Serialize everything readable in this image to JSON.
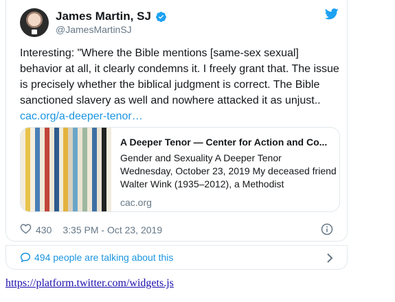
{
  "tweet": {
    "display_name": "James Martin, SJ",
    "handle": "@JamesMartinSJ",
    "text": "Interesting: \"Where the Bible mentions [same-sex sexual] behavior at all, it clearly condemns it. I freely grant that. The issue is precisely whether the biblical judgment is correct. The Bible sanctioned slavery as well and nowhere attacked it as unjust..",
    "link_text": "cac.org/a-deeper-tenor…",
    "likes": "430",
    "timestamp": "3:35 PM - Oct 23, 2019"
  },
  "card": {
    "title": "A Deeper Tenor — Center for Action and Co...",
    "description": "Gender and Sexuality A Deeper Tenor Wednesday, October 23, 2019 My deceased friend Walter Wink (1935–2012), a Methodist",
    "domain": "cac.org",
    "stripe_colors": [
      "#f3ecdc",
      "#e8c24a",
      "#f5efe0",
      "#4a7fb8",
      "#efe8d8",
      "#c1453a",
      "#ece6d6",
      "#2e5a8c",
      "#f1ebdb",
      "#e3b33e",
      "#d8d0bf",
      "#6aa6c9",
      "#ebe4d3",
      "#9fb8a0",
      "#f0e9d9",
      "#3d6fa3",
      "#e9e2d1",
      "#222222",
      "#f2ecdd"
    ]
  },
  "conversation": {
    "text": "494 people are talking about this"
  },
  "footer": {
    "url": "https://platform.twitter.com/widgets.js"
  },
  "colors": {
    "accent": "#1b95e0",
    "muted": "#657786",
    "border": "#e1e8ed"
  },
  "icons": {
    "verified": "verified-badge-icon",
    "bird": "twitter-bird-icon",
    "heart": "heart-outline-icon",
    "info": "info-icon",
    "talk": "speech-bubble-icon",
    "chevron": "chevron-right-icon"
  }
}
